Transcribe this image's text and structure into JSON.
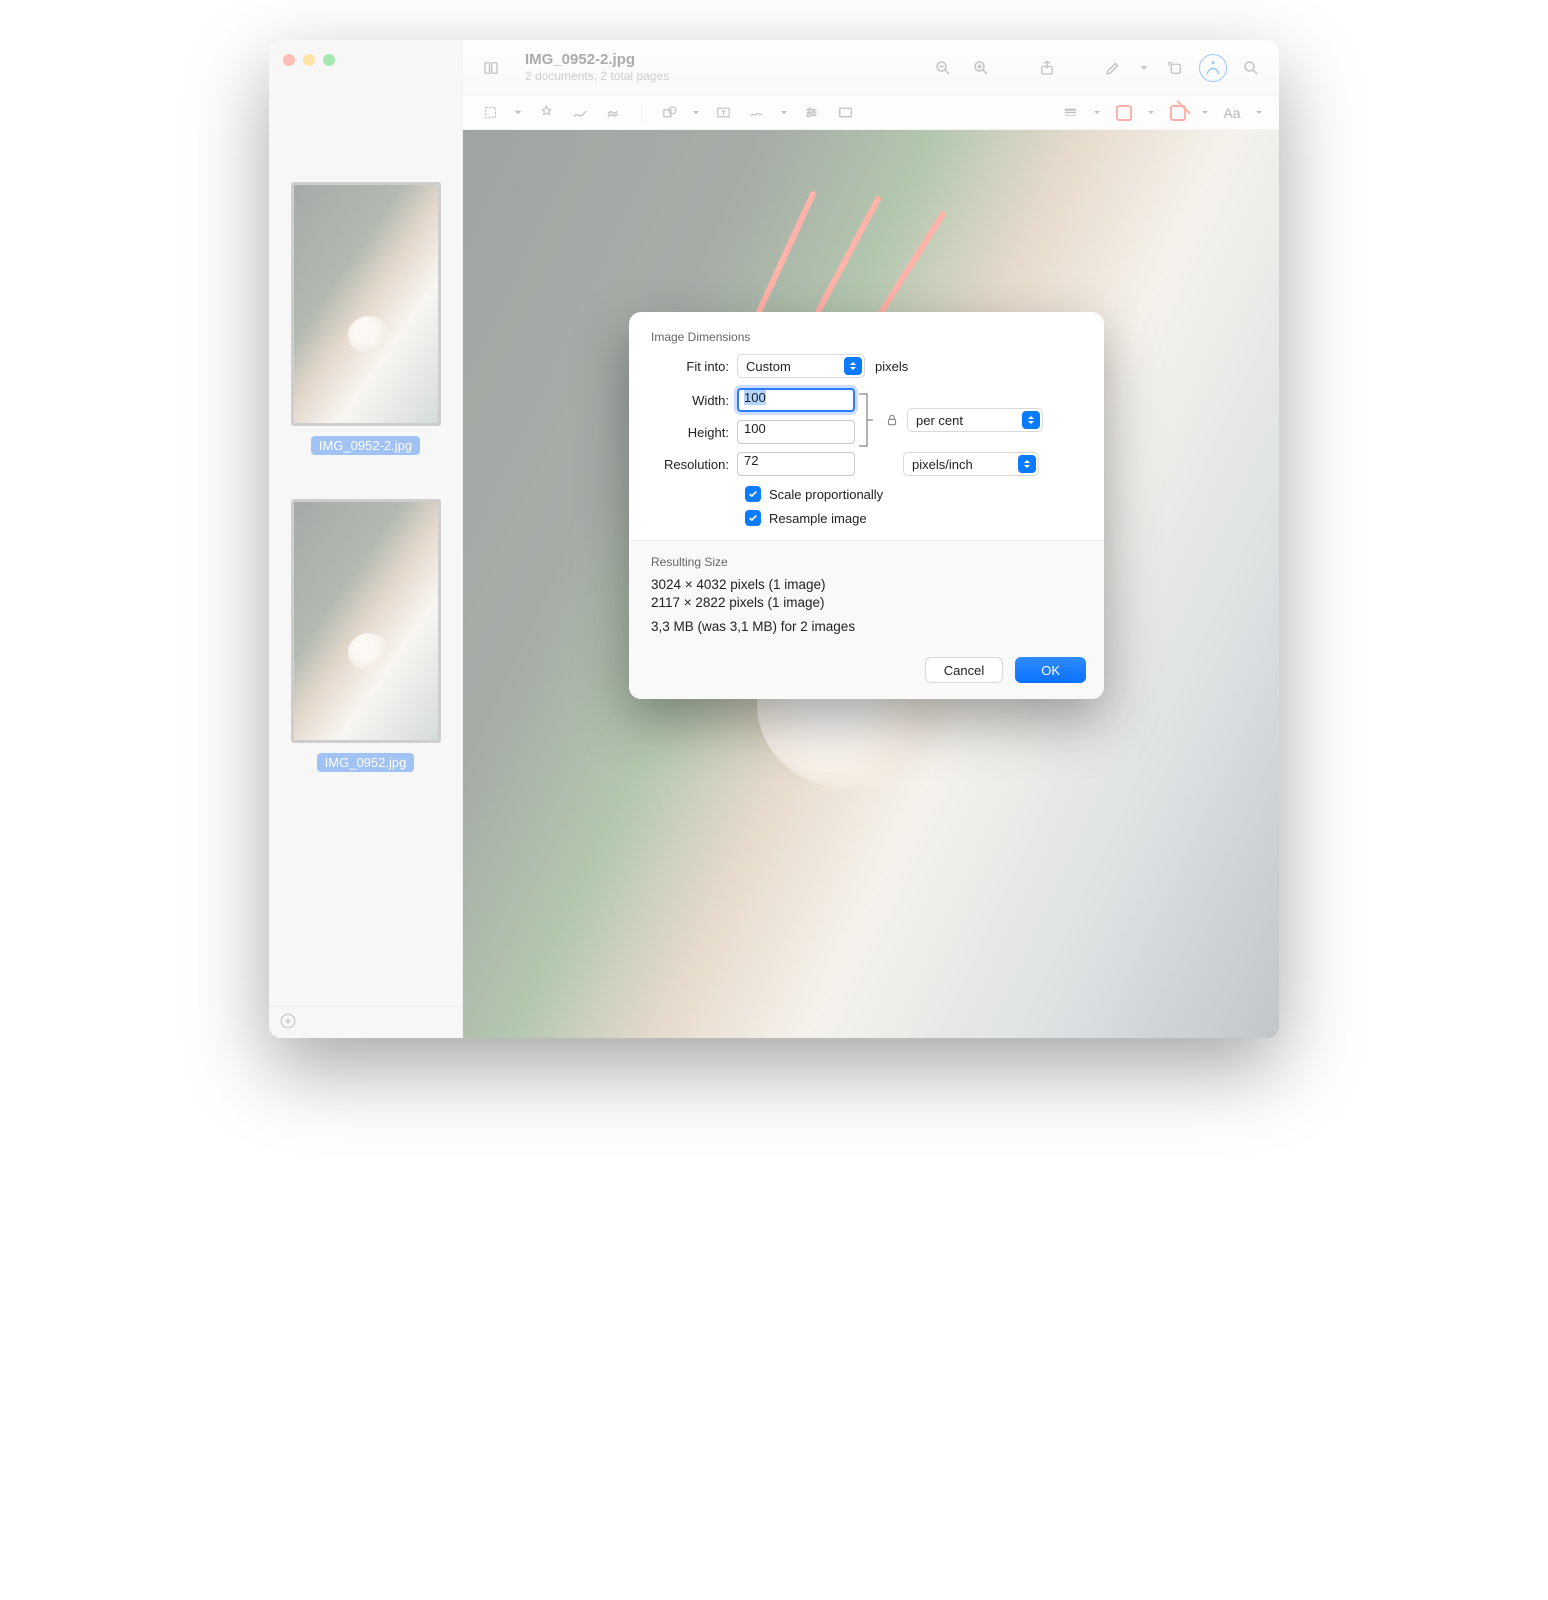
{
  "title": {
    "filename": "IMG_0952-2.jpg",
    "subtitle": "2 documents, 2 total pages"
  },
  "sidebar": {
    "thumbs": [
      {
        "label": "IMG_0952-2.jpg"
      },
      {
        "label": "IMG_0952.jpg"
      }
    ]
  },
  "dialog": {
    "section_title": "Image Dimensions",
    "fit_label": "Fit into:",
    "fit_value": "Custom",
    "fit_units": "pixels",
    "width_label": "Width:",
    "width_value": "100",
    "height_label": "Height:",
    "height_value": "100",
    "wh_units": "per cent",
    "resolution_label": "Resolution:",
    "resolution_value": "72",
    "resolution_units": "pixels/inch",
    "cb_scale": "Scale proportionally",
    "cb_resample": "Resample image",
    "result_title": "Resulting Size",
    "result_line1": "3024 × 4032 pixels (1 image)",
    "result_line2": "2117 × 2822 pixels (1 image)",
    "result_line3": "3,3 MB (was 3,1 MB) for 2 images",
    "cancel": "Cancel",
    "ok": "OK"
  }
}
